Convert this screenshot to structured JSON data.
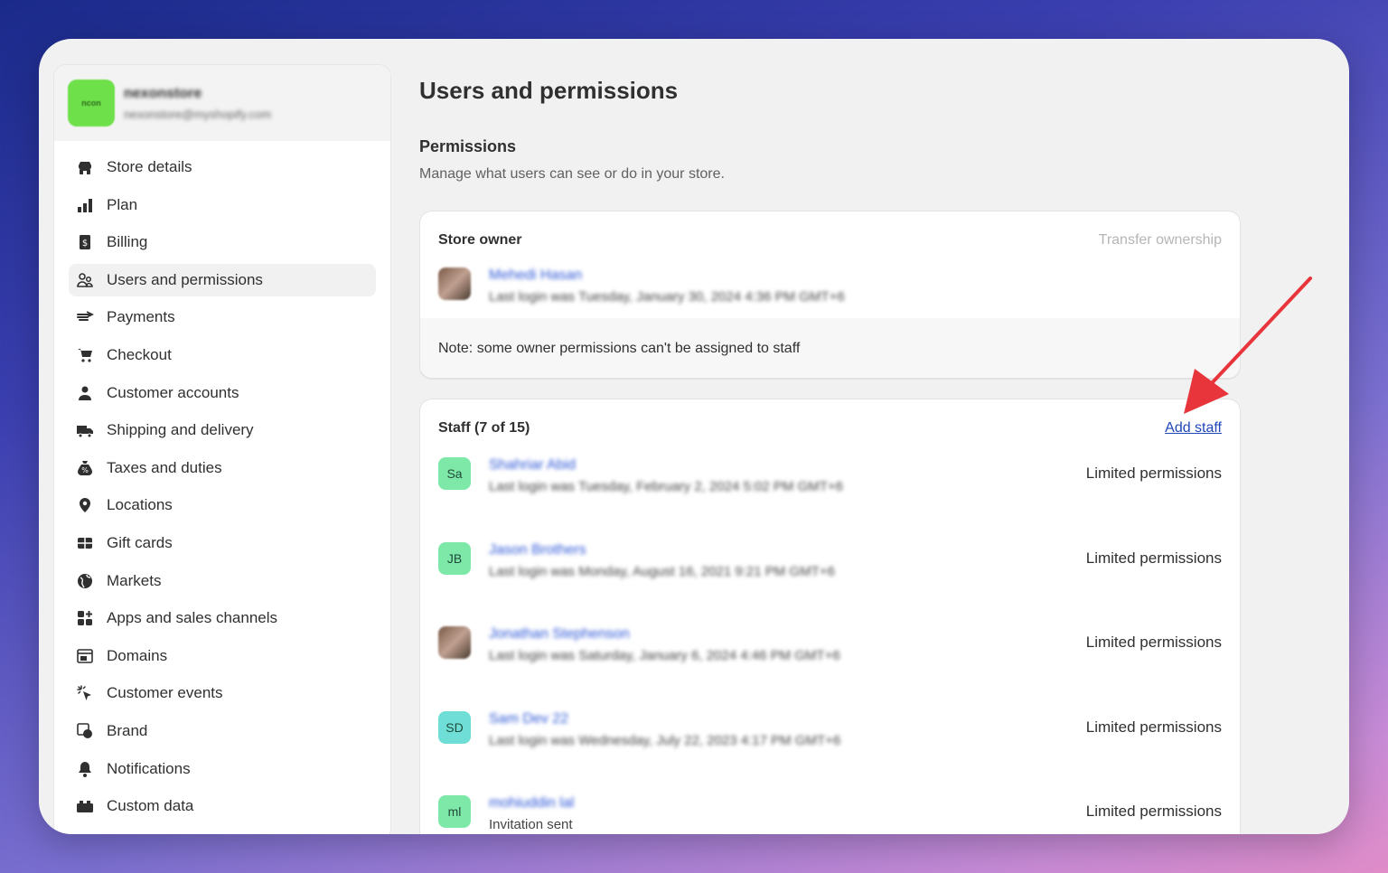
{
  "store": {
    "logo_text": "ncon",
    "name": "nexonstore",
    "email": "nexonstore@myshopify.com"
  },
  "sidebar": {
    "items": [
      {
        "label": "Store details",
        "icon": "store-icon"
      },
      {
        "label": "Plan",
        "icon": "plan-icon"
      },
      {
        "label": "Billing",
        "icon": "billing-icon"
      },
      {
        "label": "Users and permissions",
        "icon": "users-icon",
        "active": true
      },
      {
        "label": "Payments",
        "icon": "payments-icon"
      },
      {
        "label": "Checkout",
        "icon": "cart-icon"
      },
      {
        "label": "Customer accounts",
        "icon": "person-icon"
      },
      {
        "label": "Shipping and delivery",
        "icon": "truck-icon"
      },
      {
        "label": "Taxes and duties",
        "icon": "tax-icon"
      },
      {
        "label": "Locations",
        "icon": "location-pin-icon"
      },
      {
        "label": "Gift cards",
        "icon": "gift-card-icon"
      },
      {
        "label": "Markets",
        "icon": "globe-icon"
      },
      {
        "label": "Apps and sales channels",
        "icon": "apps-icon"
      },
      {
        "label": "Domains",
        "icon": "domains-icon"
      },
      {
        "label": "Customer events",
        "icon": "cursor-click-icon"
      },
      {
        "label": "Brand",
        "icon": "brand-icon"
      },
      {
        "label": "Notifications",
        "icon": "bell-icon"
      },
      {
        "label": "Custom data",
        "icon": "custom-data-icon"
      }
    ]
  },
  "main": {
    "title": "Users and permissions",
    "permissions": {
      "title": "Permissions",
      "description": "Manage what users can see or do in your store."
    },
    "owner_card": {
      "title": "Store owner",
      "transfer_label": "Transfer ownership",
      "owner": {
        "name": "Mehedi Hasan",
        "last_login": "Last login was Tuesday, January 30, 2024 4:36 PM GMT+6"
      },
      "note": "Note: some owner permissions can't be assigned to staff"
    },
    "staff_card": {
      "title": "Staff (7 of 15)",
      "add_label": "Add staff",
      "members": [
        {
          "initials": "Sa",
          "name": "Shahriar Abid",
          "sub": "Last login was Tuesday, February 2, 2024 5:02 PM GMT+6",
          "permission": "Limited permissions",
          "avatar_color": "#7ee8a8",
          "photo": false
        },
        {
          "initials": "JB",
          "name": "Jason Brothers",
          "sub": "Last login was Monday, August 16, 2021 9:21 PM GMT+6",
          "permission": "Limited permissions",
          "avatar_color": "#7ee8a8",
          "photo": false
        },
        {
          "initials": "",
          "name": "Jonathan Stephenson",
          "sub": "Last login was Saturday, January 6, 2024 4:46 PM GMT+6",
          "permission": "Limited permissions",
          "avatar_color": "#8a6a58",
          "photo": true
        },
        {
          "initials": "SD",
          "name": "Sam Dev 22",
          "sub": "Last login was Wednesday, July 22, 2023 4:17 PM GMT+6",
          "permission": "Limited permissions",
          "avatar_color": "#6fded6",
          "photo": false
        },
        {
          "initials": "ml",
          "name": "mohiuddin lal",
          "sub": "Invitation sent",
          "permission": "Limited permissions",
          "avatar_color": "#7ee8a8",
          "photo": false
        }
      ]
    }
  },
  "colors": {
    "link": "#1f47b8",
    "annotation_arrow": "#e8353b"
  }
}
